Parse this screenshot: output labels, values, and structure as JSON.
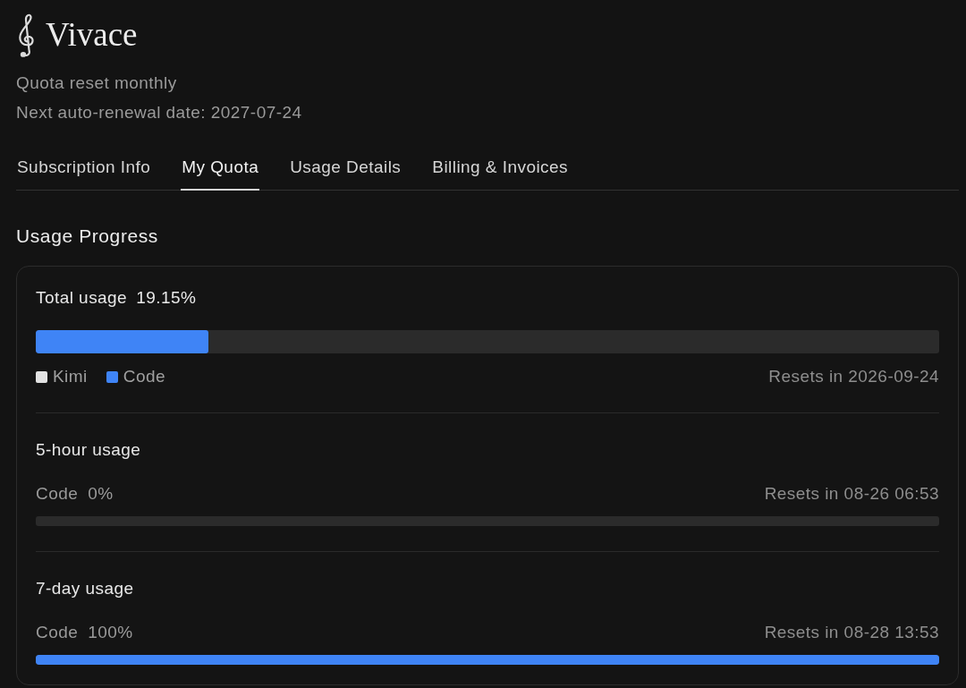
{
  "brand": {
    "name": "Vivace"
  },
  "plan_notes": [
    "Quota reset monthly",
    "Next auto-renewal date: 2027-07-24"
  ],
  "tabs": [
    {
      "label": "Subscription Info",
      "selected": false
    },
    {
      "label": "My Quota",
      "selected": true
    },
    {
      "label": "Usage Details",
      "selected": false
    },
    {
      "label": "Billing & Invoices",
      "selected": false
    }
  ],
  "usage_progress": {
    "title": "Usage Progress",
    "total": {
      "label": "Total usage",
      "value": "19.15%",
      "level": 0.1915,
      "legend": [
        {
          "label": "Kimi",
          "color": "#e2e2e2"
        },
        {
          "label": "Code",
          "color": "#3f84f6"
        }
      ],
      "reset": "Resets in 2026-09-24"
    },
    "windows": [
      {
        "title": "5-hour usage",
        "label": "Code",
        "value": "0%",
        "level": 0,
        "reset": "Resets in 08-26 06:53"
      },
      {
        "title": "7-day usage",
        "label": "Code",
        "value": "100%",
        "level": 1,
        "reset": "Resets in 08-28 13:53"
      }
    ]
  }
}
